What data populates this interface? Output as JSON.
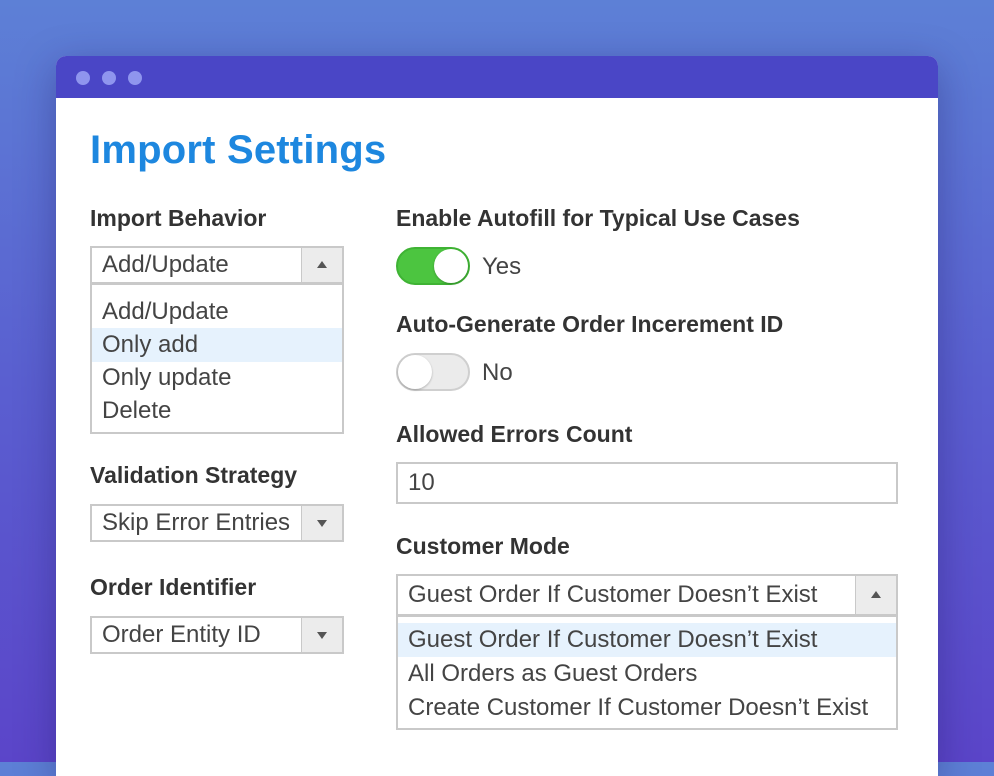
{
  "page": {
    "title": "Import Settings"
  },
  "import_behavior": {
    "label": "Import Behavior",
    "selected": "Add/Update",
    "options": [
      "Add/Update",
      "Only add",
      "Only update",
      "Delete"
    ],
    "highlighted_option": "Only add"
  },
  "validation_strategy": {
    "label": "Validation Strategy",
    "selected": "Skip Error Entries"
  },
  "order_identifier": {
    "label": "Order Identifier",
    "selected": "Order Entity ID"
  },
  "autofill": {
    "label": "Enable Autofill for Typical Use Cases",
    "state_text": "Yes",
    "enabled": true
  },
  "auto_generate_increment": {
    "label": "Auto-Generate Order Incerement ID",
    "state_text": "No",
    "enabled": false
  },
  "allowed_errors": {
    "label": "Allowed Errors Count",
    "value": "10"
  },
  "customer_mode": {
    "label": "Customer Mode",
    "selected": "Guest Order If Customer Doesn’t Exist",
    "options": [
      "Guest Order If Customer Doesn’t Exist",
      "All Orders as Guest Orders",
      "Create Customer If Customer Doesn’t Exist"
    ],
    "highlighted_option": "Guest Order If Customer Doesn’t Exist"
  },
  "colors": {
    "title": "#1d87df",
    "titlebar": "#4a46c6",
    "toggle_on": "#4cc540",
    "option_highlight": "#e6f2fd"
  },
  "icons": {
    "window_dots": "window-control-dot",
    "dropdown_open": "triangle-up-icon",
    "dropdown_closed": "triangle-down-icon"
  }
}
